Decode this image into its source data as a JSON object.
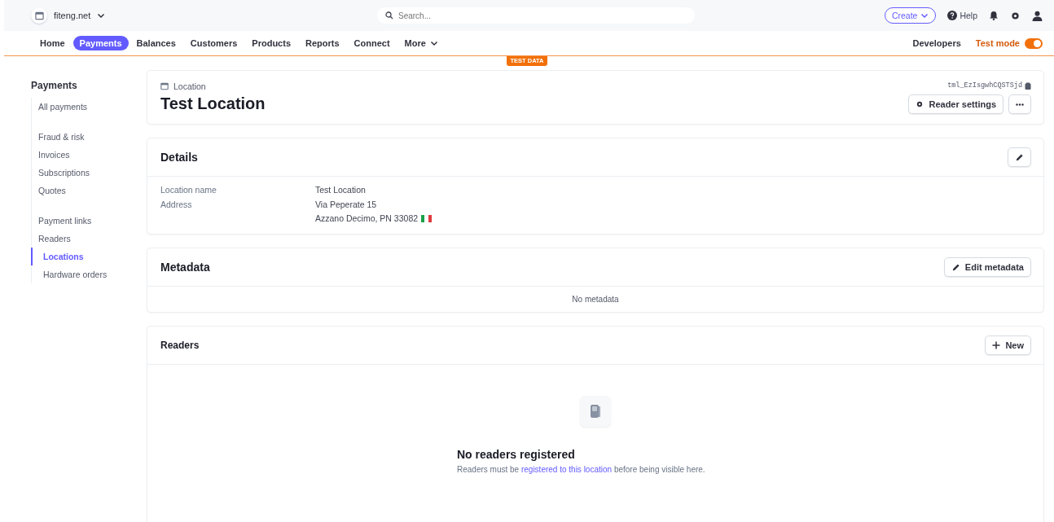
{
  "account": {
    "name": "fiteng.net"
  },
  "search": {
    "placeholder": "Search..."
  },
  "top_actions": {
    "create": "Create",
    "help": "Help"
  },
  "nav": [
    {
      "label": "Home",
      "selected": false
    },
    {
      "label": "Payments",
      "selected": true
    },
    {
      "label": "Balances",
      "selected": false
    },
    {
      "label": "Customers",
      "selected": false
    },
    {
      "label": "Products",
      "selected": false
    },
    {
      "label": "Reports",
      "selected": false
    },
    {
      "label": "Connect",
      "selected": false
    }
  ],
  "more": "More",
  "nav_right": {
    "developers": "Developers",
    "test_mode": {
      "label": "Test mode",
      "on": true
    }
  },
  "test_badge": "TEST DATA",
  "sidebar": {
    "title": "Payments",
    "groups": [
      {
        "items": [
          {
            "label": "All payments",
            "selected": false
          }
        ]
      },
      {
        "items": [
          {
            "label": "Fraud & risk",
            "selected": false
          },
          {
            "label": "Invoices",
            "selected": false
          },
          {
            "label": "Subscriptions",
            "selected": false
          },
          {
            "label": "Quotes",
            "selected": false
          }
        ]
      },
      {
        "items": [
          {
            "label": "Payment links",
            "selected": false
          },
          {
            "label": "Readers",
            "selected": false,
            "children": [
              {
                "label": "Locations",
                "selected": true
              },
              {
                "label": "Hardware orders",
                "selected": false
              }
            ]
          }
        ]
      }
    ]
  },
  "header": {
    "kind_label": "Location",
    "title": "Test Location",
    "id": "tml_EzIsgwhCQSTSjd",
    "settings_button": "Reader settings"
  },
  "details": {
    "title": "Details",
    "rows": [
      {
        "label": "Location name",
        "lines": [
          "Test Location"
        ],
        "flag": false
      },
      {
        "label": "Address",
        "lines": [
          "Via Peperate 15",
          "Azzano Decimo, PN 33082"
        ],
        "flag": true
      }
    ]
  },
  "metadata": {
    "title": "Metadata",
    "button": "Edit metadata",
    "empty": "No metadata"
  },
  "readers": {
    "title": "Readers",
    "button": "New",
    "empty_title": "No readers registered",
    "empty_before": "Readers must be ",
    "empty_link": "registered to this location",
    "empty_after": " before being visible here."
  }
}
